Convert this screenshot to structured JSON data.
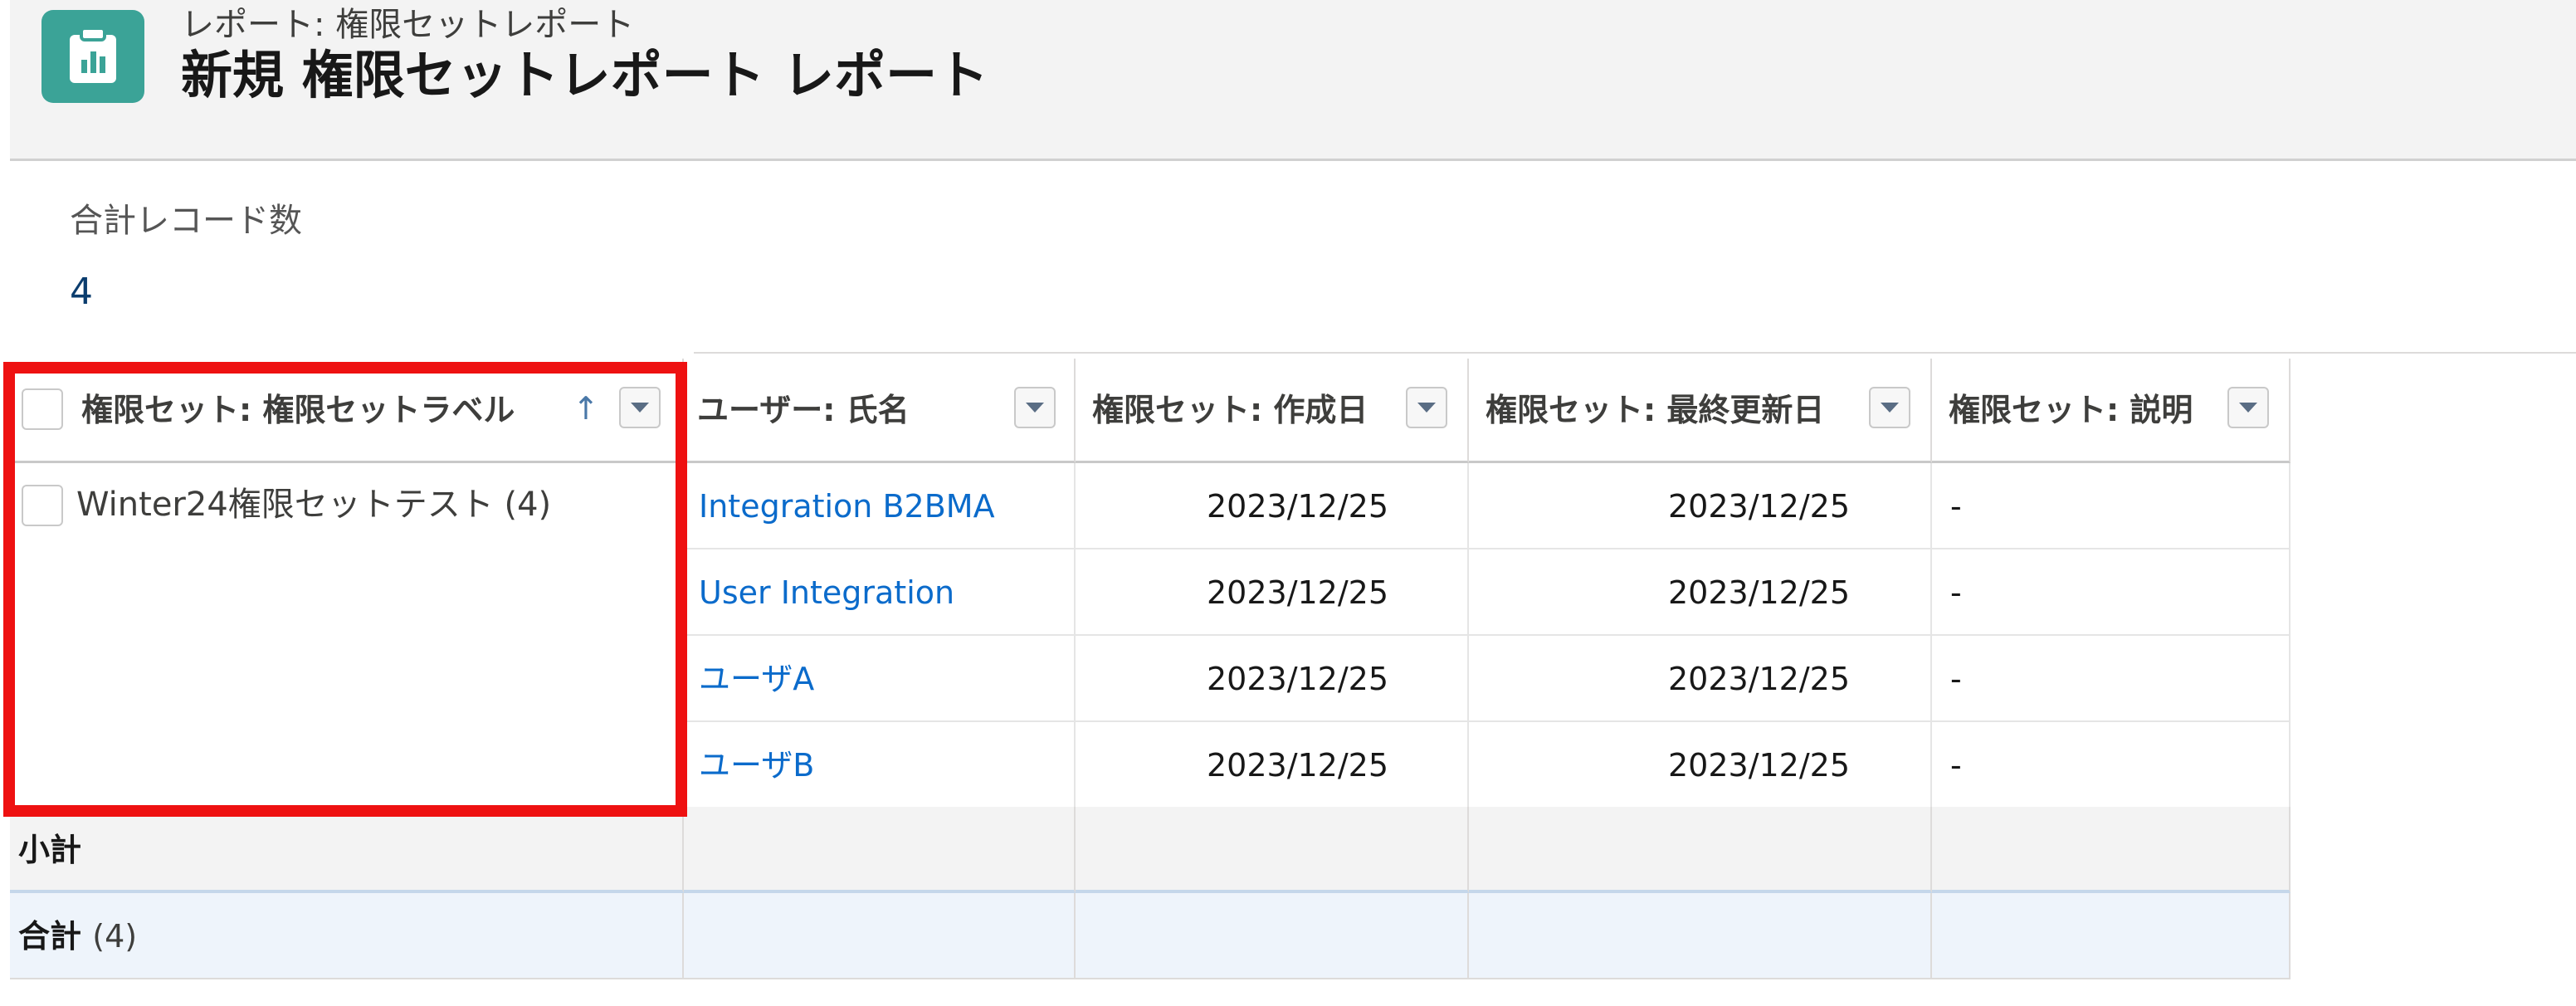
{
  "header": {
    "subtitle": "レポート: 権限セットレポート",
    "title": "新規 権限セットレポート レポート",
    "icon": "report-icon"
  },
  "summary": {
    "record_count_label": "合計レコード数",
    "record_count": "4"
  },
  "table": {
    "columns": [
      {
        "label": "権限セット: 権限セットラベル",
        "sort_indicator": "↑"
      },
      {
        "label": "ユーザー: 氏名"
      },
      {
        "label": "権限セット: 作成日"
      },
      {
        "label": "権限セット: 最終更新日"
      },
      {
        "label": "権限セット: 説明"
      }
    ],
    "group": {
      "label": "Winter24権限セットテスト (4)"
    },
    "rows": [
      {
        "name": "Integration B2BMA",
        "created": "2023/12/25",
        "modified": "2023/12/25",
        "description": "-"
      },
      {
        "name": "User Integration",
        "created": "2023/12/25",
        "modified": "2023/12/25",
        "description": "-"
      },
      {
        "name": "ユーザA",
        "created": "2023/12/25",
        "modified": "2023/12/25",
        "description": "-"
      },
      {
        "name": "ユーザB",
        "created": "2023/12/25",
        "modified": "2023/12/25",
        "description": "-"
      }
    ],
    "subtotal_label": "小計",
    "total_label": "合計",
    "total_count": "(4)"
  },
  "colors": {
    "header_bg": "#f3f3f3",
    "icon_bg": "#3ba397",
    "link": "#0b6bcb",
    "highlight": "#ee1111",
    "total_row_bg": "#eef4fb"
  }
}
